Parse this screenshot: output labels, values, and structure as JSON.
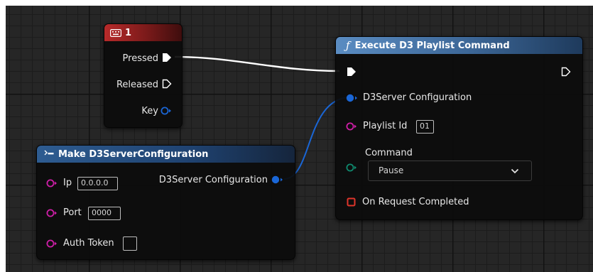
{
  "colors": {
    "exec": "#ffffff",
    "struct": "#1a66d6",
    "string": "#d01fa8",
    "enum": "#0f8a6e",
    "delegate": "#e0352b",
    "key_header": "#8a1a1a",
    "function_header": "#4a77a8",
    "make_header": "#234b78"
  },
  "key_node": {
    "title": "1",
    "icon": "keyboard-icon",
    "pressed_label": "Pressed",
    "released_label": "Released",
    "key_label": "Key"
  },
  "execute_node": {
    "title": "Execute D3 Playlist Command",
    "icon": "function-icon",
    "server_config_label": "D3Server Configuration",
    "playlist_id_label": "Playlist Id",
    "playlist_id_value": "01",
    "command_label": "Command",
    "command_value": "Pause",
    "on_request_completed_label": "On Request Completed"
  },
  "make_node": {
    "title": "Make D3ServerConfiguration",
    "icon": "make-struct-icon",
    "ip_label": "Ip",
    "ip_value": "0.0.0.0",
    "port_label": "Port",
    "port_value": "0000",
    "auth_token_label": "Auth Token",
    "auth_token_value": "",
    "output_label": "D3Server Configuration"
  }
}
